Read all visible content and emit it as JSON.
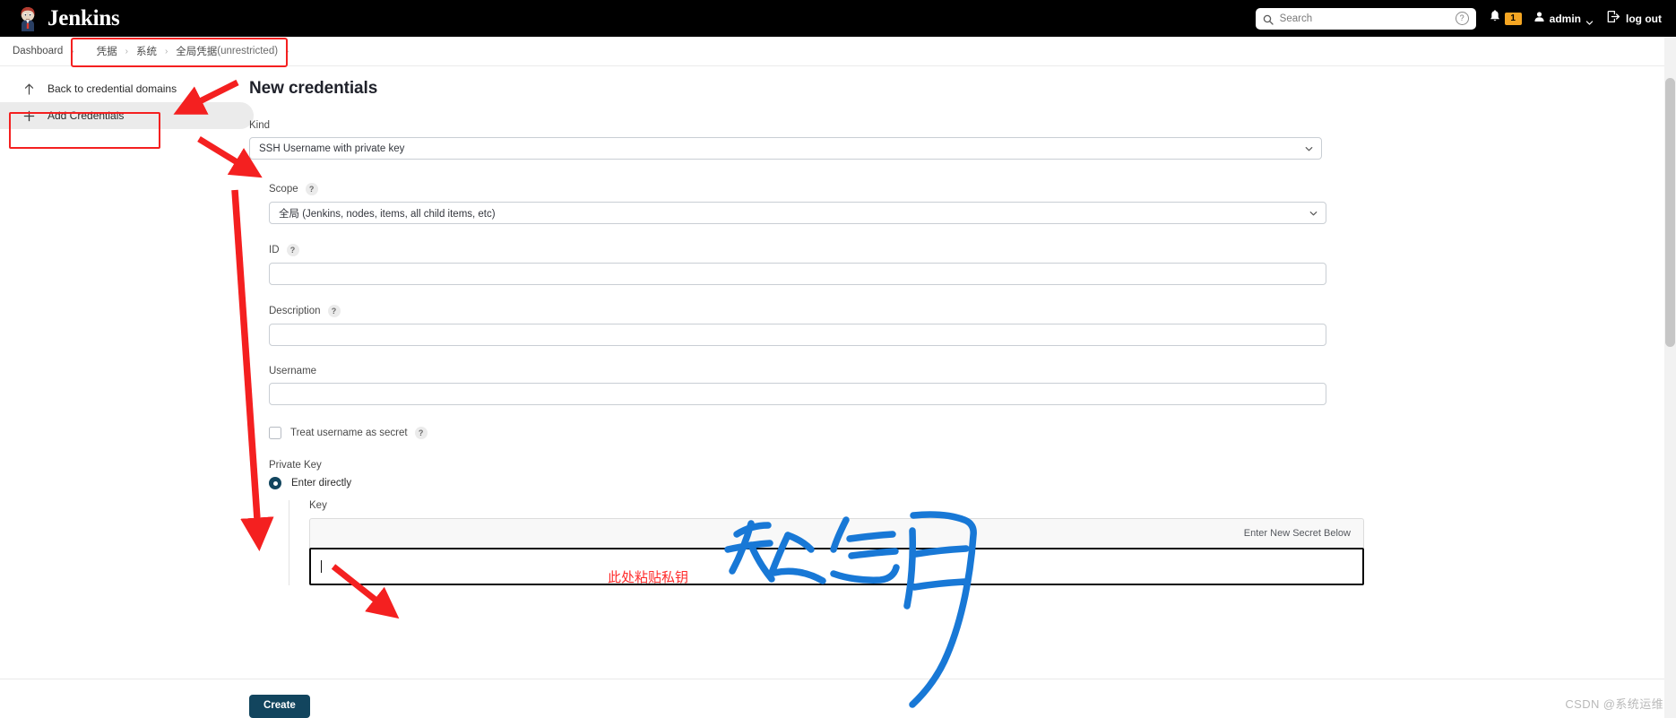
{
  "header": {
    "brand": "Jenkins",
    "brand_logo_icon": "jenkins-butler-logo",
    "search": {
      "placeholder": "Search",
      "value": "",
      "icon": "search-icon",
      "help_icon": "question-circle-icon"
    },
    "notifications": {
      "icon": "bell-icon",
      "count": "1",
      "badge_color": "#f5a623"
    },
    "user": {
      "icon": "user-icon",
      "name": "admin",
      "chevron_icon": "chevron-down-icon"
    },
    "logout": {
      "icon": "logout-arrow-icon",
      "label": "log out"
    }
  },
  "breadcrumb": {
    "items": [
      {
        "label": "Dashboard"
      },
      {
        "label": "凭据"
      },
      {
        "label": "系统"
      },
      {
        "label": "全局凭据",
        "suffix": " (unrestricted)"
      }
    ],
    "separator": "›"
  },
  "sidebar": {
    "items": [
      {
        "label": "Back to credential domains",
        "icon": "arrow-up-icon",
        "active": false
      },
      {
        "label": "Add Credentials",
        "icon": "plus-icon",
        "active": true
      }
    ]
  },
  "main": {
    "title": "New credentials",
    "kind": {
      "label": "Kind",
      "value": "SSH Username with private key"
    },
    "scope": {
      "label": "Scope",
      "help": "?",
      "value": "全局 (Jenkins, nodes, items, all child items, etc)"
    },
    "id": {
      "label": "ID",
      "help": "?",
      "value": "",
      "placeholder": ""
    },
    "description": {
      "label": "Description",
      "help": "?",
      "value": "",
      "placeholder": ""
    },
    "username": {
      "label": "Username",
      "value": "",
      "placeholder": ""
    },
    "treat_username_as_secret": {
      "label": "Treat username as secret",
      "help": "?",
      "checked": false
    },
    "private_key": {
      "label": "Private Key",
      "option_enter_directly": {
        "label": "Enter directly",
        "selected": true
      },
      "key_label": "Key",
      "secret_header": "Enter New Secret Below",
      "secret_value": ""
    },
    "create_button": "Create"
  },
  "annotations": {
    "red_note": "此处粘贴私钥",
    "blue_handwriting": "私钥",
    "arrow_color": "#f42020",
    "box_color": "#f42020",
    "blue_color": "#1878d6"
  },
  "watermark": "CSDN @系统运维"
}
